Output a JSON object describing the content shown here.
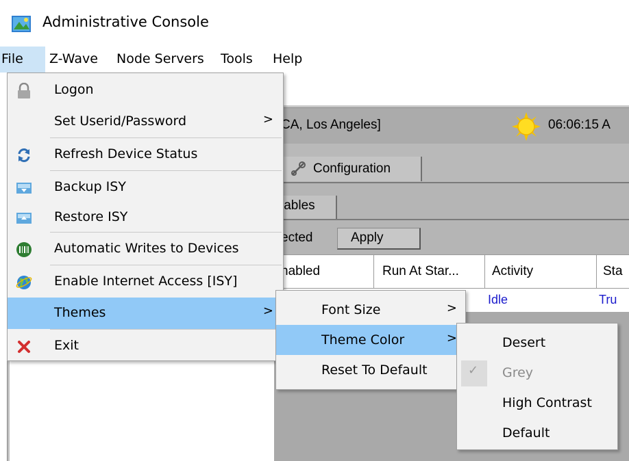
{
  "window": {
    "title": "Administrative Console"
  },
  "menubar": {
    "items": [
      "File",
      "Z-Wave",
      "Node Servers",
      "Tools",
      "Help"
    ]
  },
  "file_menu": {
    "items": [
      {
        "label": "Logon",
        "icon": "lock-icon"
      },
      {
        "label": "Set Userid/Password",
        "submenu": ">"
      },
      {
        "label": "Refresh Device Status",
        "icon": "refresh-icon"
      },
      {
        "label": "Backup ISY",
        "icon": "backup-icon"
      },
      {
        "label": "Restore ISY",
        "icon": "restore-icon"
      },
      {
        "label": "Automatic Writes to Devices",
        "icon": "barcode-icon"
      },
      {
        "label": "Enable Internet Access  [ISY]",
        "icon": "globe-icon"
      },
      {
        "label": "Themes",
        "submenu": ">"
      },
      {
        "label": "Exit",
        "icon": "close-icon"
      }
    ]
  },
  "themes_menu": {
    "items": [
      {
        "label": "Font Size",
        "submenu": ">"
      },
      {
        "label": "Theme Color",
        "submenu": ">"
      },
      {
        "label": "Reset To Default"
      }
    ]
  },
  "theme_color_menu": {
    "check_mark": "✓",
    "items": [
      {
        "label": "Desert"
      },
      {
        "label": "Grey",
        "checked": true
      },
      {
        "label": "High Contrast"
      },
      {
        "label": "Default"
      }
    ]
  },
  "background": {
    "status_location": "CA, Los Angeles]",
    "status_time": "06:06:15 A",
    "config_tab": "Configuration",
    "variables_tab": "iables",
    "selected_label": "ected",
    "apply_button": "Apply",
    "table": {
      "headers": [
        "nabled",
        "Run At Star...",
        "Activity",
        "Sta"
      ],
      "row": [
        "Idle",
        "Tru"
      ]
    }
  },
  "colors": {
    "menu_highlight": "#91c9f7",
    "menubar_highlight": "#cce4f7",
    "menu_bg": "#f2f2f2",
    "status_bar_bg": "#ababab",
    "table_value_blue": "#1a1acc"
  }
}
